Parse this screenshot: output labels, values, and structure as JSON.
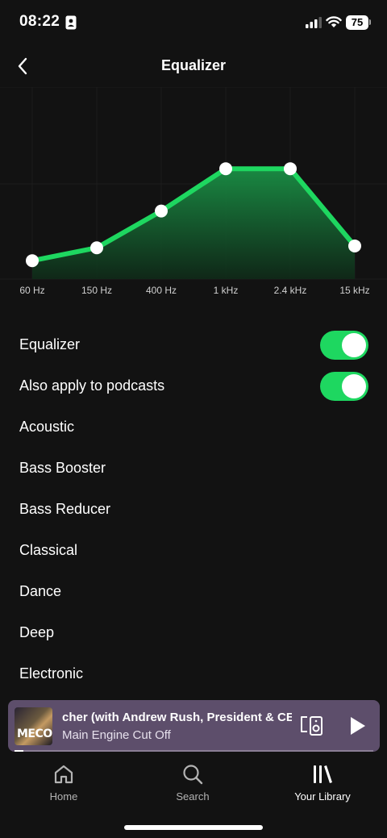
{
  "status_bar": {
    "time": "08:22",
    "battery": "75"
  },
  "header": {
    "title": "Equalizer",
    "back_icon": "chevron-left-icon"
  },
  "equalizer": {
    "bands": [
      "60 Hz",
      "150 Hz",
      "400 Hz",
      "1 kHz",
      "2.4 kHz",
      "15 kHz"
    ],
    "gains": [
      0.1,
      0.17,
      0.37,
      0.6,
      0.6,
      0.18
    ],
    "accent_color": "#1ed760"
  },
  "settings": {
    "equalizer_toggle": {
      "label": "Equalizer",
      "on": true
    },
    "podcasts_toggle": {
      "label": "Also apply to podcasts",
      "on": true
    },
    "presets": [
      "Acoustic",
      "Bass Booster",
      "Bass Reducer",
      "Classical",
      "Dance",
      "Deep",
      "Electronic"
    ]
  },
  "now_playing": {
    "title": "cher (with Andrew Rush, President & CEO)",
    "artist": "Main Engine Cut Off",
    "album_art_text": "MECO",
    "progress": 0.025,
    "background_color": "#5d4e6b"
  },
  "bottom_nav": {
    "home": "Home",
    "search": "Search",
    "library": "Your Library"
  }
}
